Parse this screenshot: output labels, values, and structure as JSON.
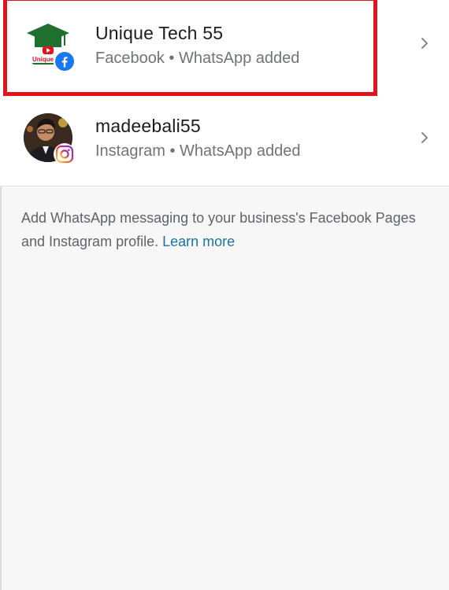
{
  "accounts": [
    {
      "name": "Unique Tech 55",
      "subtitle": "Facebook • WhatsApp added",
      "avatar_icon": "graduation-cap-logo",
      "platform_icon": "facebook-icon",
      "logo_text": "Unique"
    },
    {
      "name": "madeebali55",
      "subtitle": "Instagram • WhatsApp added",
      "avatar_icon": "profile-photo",
      "platform_icon": "instagram-icon"
    }
  ],
  "info": {
    "text": "Add WhatsApp messaging to your business's Facebook Pages and Instagram profile. ",
    "link": "Learn more"
  },
  "colors": {
    "highlight": "#e2131a",
    "link": "#1a73a8",
    "facebook": "#1877f2",
    "instagram_gradient": [
      "#feda75",
      "#fa7e1e",
      "#d62976",
      "#962fbf",
      "#4f5bd5"
    ]
  }
}
